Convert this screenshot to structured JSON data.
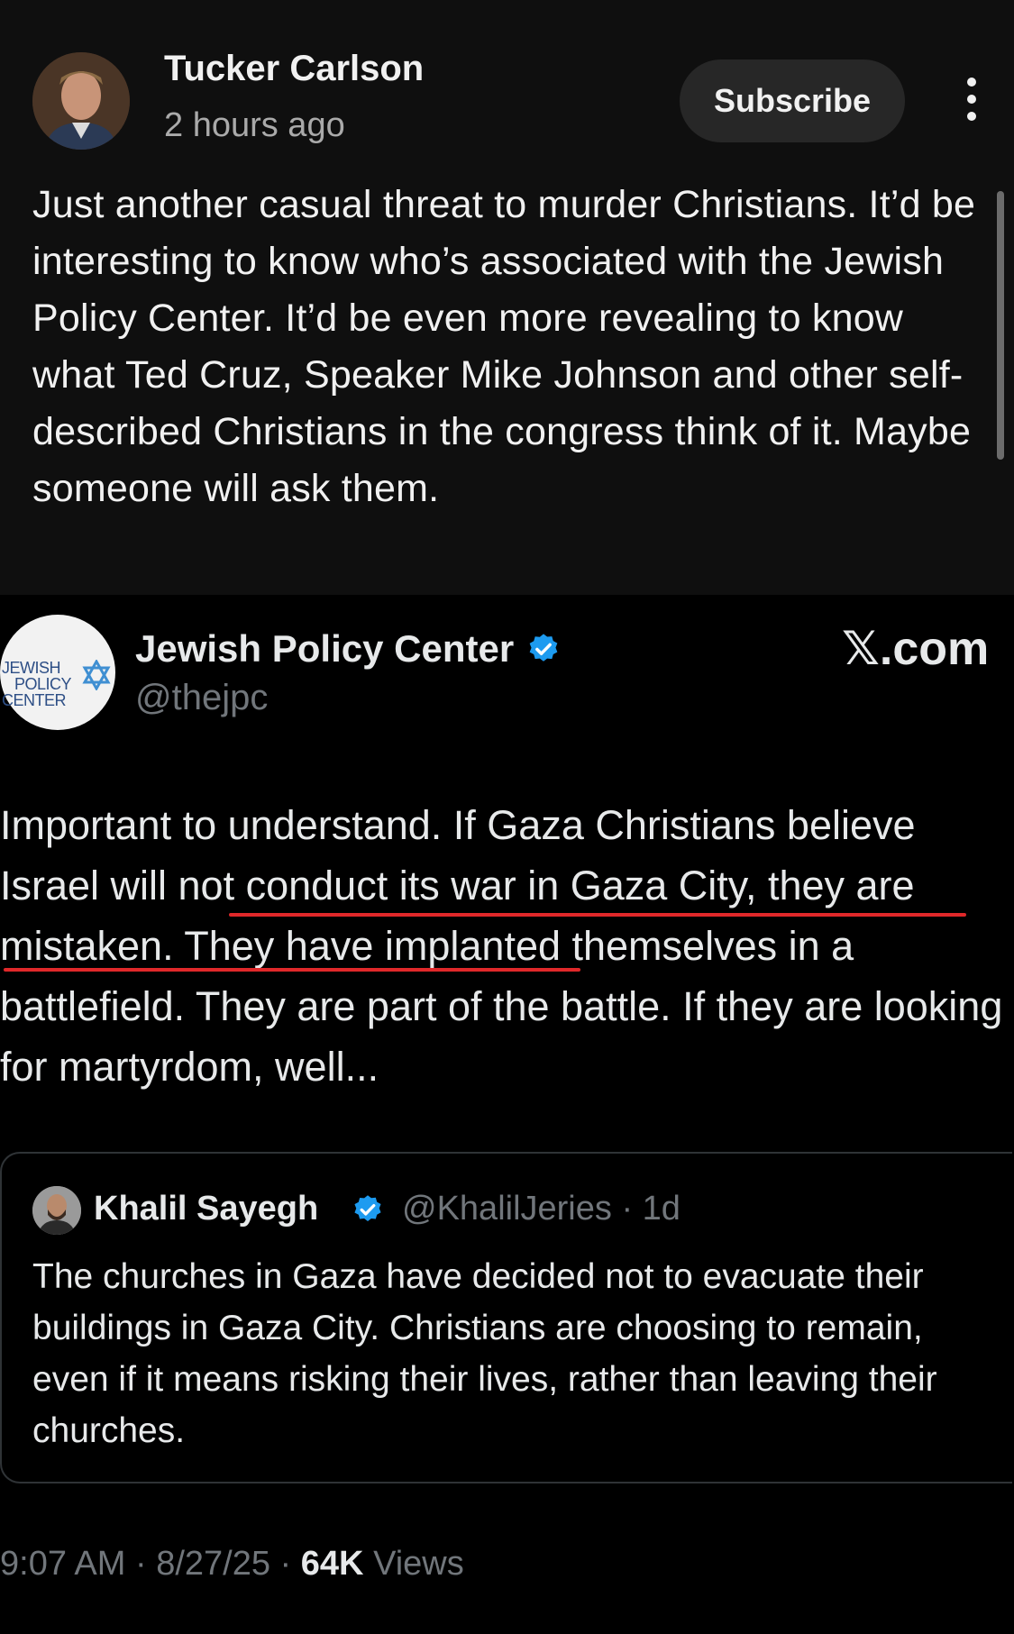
{
  "post": {
    "author": "Tucker Carlson",
    "time": "2 hours ago",
    "subscribe_label": "Subscribe",
    "text": "Just another casual threat to murder Christians. It’d be interesting to know who’s associated with the Jewish Policy Center. It’d be even more revealing to know what Ted Cruz, Speaker Mike Johnson and other self-described Christians in the congress think of it. Maybe someone will ask them."
  },
  "embed": {
    "logo_text": [
      "JEWISH",
      "POLICY",
      "CENTER"
    ],
    "account_name": "Jewish Policy Center",
    "handle": "@thejpc",
    "source": "𝕏.com",
    "tweet_plain": "Important to understand. If Gaza Christians believe Israel will not conduct its war in Gaza City, they are mistaken. They have implanted themselves in a battlefield. ",
    "tweet_underlined": "They are part of the battle. If they are looking for martyrdom, well...",
    "quote": {
      "name": "Khalil Sayegh",
      "handle": "@KhalilJeries",
      "age": "· 1d",
      "text": "The churches in Gaza have decided not to evacuate their buildings in Gaza City. Christians are choosing to remain, even if it means risking their lives, rather than leaving their churches."
    },
    "meta": {
      "time": "9:07 AM",
      "date": "8/27/25",
      "views_count": "64K",
      "views_label": "Views"
    }
  },
  "colors": {
    "background": "#0f0f0f",
    "embed_background": "#000000",
    "verified": "#1d9bf0",
    "underline": "#e0282a",
    "muted_text": "#71767b"
  }
}
